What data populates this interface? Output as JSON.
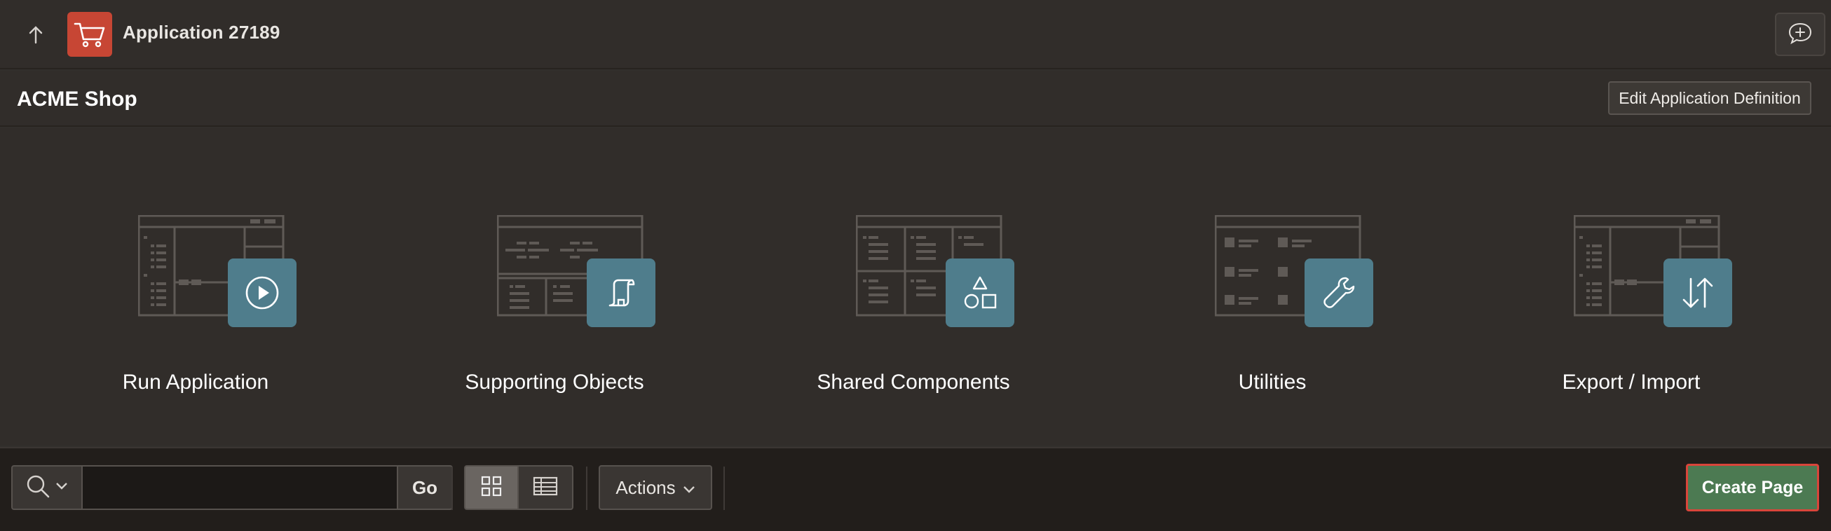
{
  "header": {
    "app_title": "Application 27189",
    "up_icon": "arrow-up-icon",
    "app_icon": "shopping-cart-icon",
    "feedback_icon": "chat-plus-icon"
  },
  "subheader": {
    "title": "ACME Shop",
    "edit_button": "Edit Application Definition"
  },
  "tiles": [
    {
      "label": "Run Application",
      "icon": "play-icon"
    },
    {
      "label": "Supporting Objects",
      "icon": "scroll-icon"
    },
    {
      "label": "Shared Components",
      "icon": "shapes-icon"
    },
    {
      "label": "Utilities",
      "icon": "wrench-icon"
    },
    {
      "label": "Export / Import",
      "icon": "transfer-arrows-icon"
    }
  ],
  "toolbar": {
    "search_placeholder": "",
    "search_value": "",
    "go_label": "Go",
    "actions_label": "Actions",
    "create_label": "Create Page"
  },
  "colors": {
    "background": "#312d2a",
    "toolbar": "#221e1b",
    "tile_badge": "#4f7d8c",
    "app_icon": "#c74634",
    "create_button": "#4c7a52",
    "highlight_border": "#d9453a"
  }
}
